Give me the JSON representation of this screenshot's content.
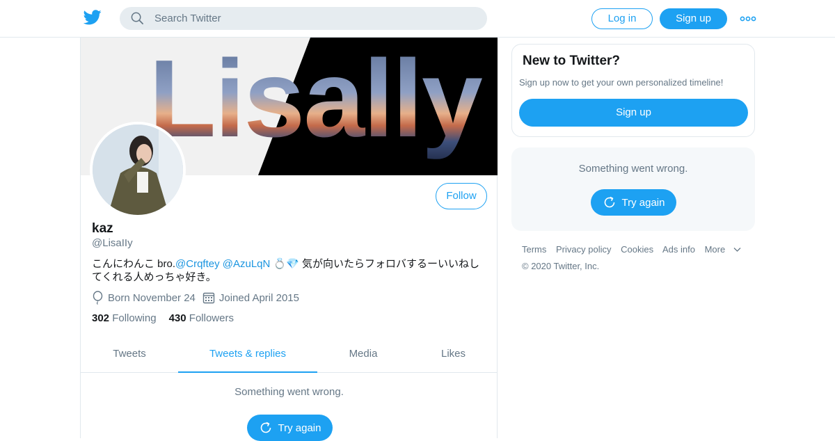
{
  "header": {
    "logo_icon": "twitter-bird-icon",
    "search_placeholder": "Search Twitter",
    "login_label": "Log in",
    "signup_label": "Sign up",
    "more_icon": "more-dots-icon"
  },
  "banner": {
    "text": "Lisally"
  },
  "profile": {
    "follow_label": "Follow",
    "name": "kaz",
    "handle": "@LisaIIy",
    "bio_prefix": "こんにわんこ bro.",
    "bio_link1": "@Crqftey",
    "bio_space": " ",
    "bio_link2": "@AzuLqN",
    "bio_suffix": " 💍💎 気が向いたらフォロバするーいいねしてくれる人めっちゃ好き。",
    "born": "Born November 24",
    "joined": "Joined April 2015",
    "following_count": "302",
    "following_label": "Following",
    "followers_count": "430",
    "followers_label": "Followers"
  },
  "tabs": [
    {
      "label": "Tweets"
    },
    {
      "label": "Tweets & replies"
    },
    {
      "label": "Media"
    },
    {
      "label": "Likes"
    }
  ],
  "timeline": {
    "error": "Something went wrong.",
    "try_again": "Try again"
  },
  "sidebar": {
    "new_title": "New to Twitter?",
    "new_sub": "Sign up now to get your own personalized timeline!",
    "new_signup": "Sign up",
    "error": "Something went wrong.",
    "try_again": "Try again",
    "footer_links": [
      "Terms",
      "Privacy policy",
      "Cookies",
      "Ads info",
      "More"
    ],
    "copyright": "© 2020 Twitter, Inc."
  },
  "colors": {
    "accent": "#1da1f2",
    "text_secondary": "#657786",
    "border": "#e1e8ed"
  }
}
